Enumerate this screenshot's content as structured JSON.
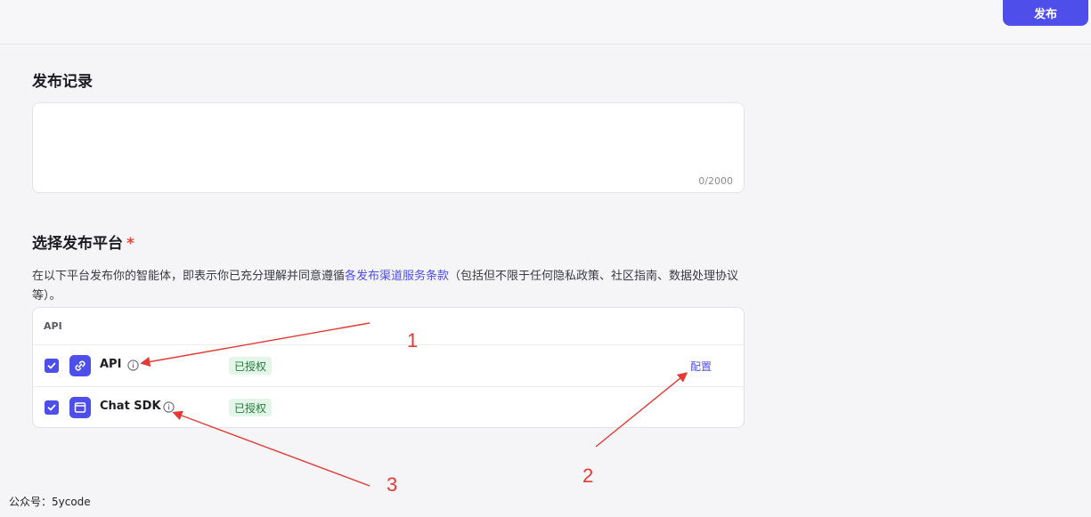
{
  "header": {
    "publish_label": "发布"
  },
  "release_record": {
    "title": "发布记录",
    "counter": "0/2000"
  },
  "platform": {
    "title": "选择发布平台",
    "required_mark": "*",
    "desc_prefix": "在以下平台发布你的智能体，即表示你已充分理解并同意遵循",
    "desc_link": "各发布渠道服务条款",
    "desc_suffix": "（包括但不限于任何隐私政策、社区指南、数据处理协议等）。",
    "group_header": "API",
    "rows": [
      {
        "label": "API",
        "status": "已授权",
        "action": "配置",
        "checked": true,
        "icon": "link-icon"
      },
      {
        "label": "Chat SDK",
        "status": "已授权",
        "action": "",
        "checked": true,
        "icon": "window-icon"
      }
    ]
  },
  "annotations": [
    "1",
    "2",
    "3"
  ],
  "watermark": "公众号：5ycode",
  "colors": {
    "accent": "#4e4eea",
    "annotation": "#e53935",
    "badge_bg": "#e4f6e8",
    "badge_text": "#1e7d3a"
  }
}
